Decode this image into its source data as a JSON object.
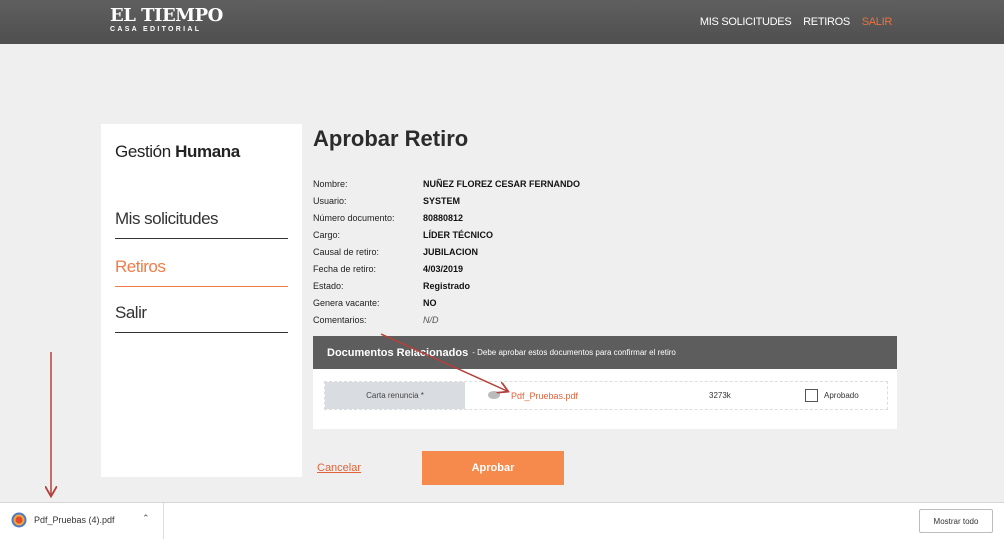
{
  "header": {
    "logo_title": "EL TIEMPO",
    "logo_subtitle": "CASA EDITORIAL",
    "nav": [
      "MIS SOLICITUDES",
      "RETIROS",
      "SALIR"
    ]
  },
  "sidebar": {
    "title_light": "Gestión",
    "title_bold": "Humana",
    "items": [
      "Mis solicitudes",
      "Retiros",
      "Salir"
    ],
    "active_index": 1
  },
  "main": {
    "title": "Aprobar Retiro",
    "fields": [
      {
        "label": "Nombre:",
        "value": "NUÑEZ FLOREZ CESAR FERNANDO"
      },
      {
        "label": "Usuario:",
        "value": "SYSTEM"
      },
      {
        "label": "Número documento:",
        "value": "80880812"
      },
      {
        "label": "Cargo:",
        "value": "LÍDER TÉCNICO"
      },
      {
        "label": "Causal de retiro:",
        "value": "JUBILACION"
      },
      {
        "label": "Fecha de retiro:",
        "value": "4/03/2019"
      },
      {
        "label": "Estado:",
        "value": "Registrado"
      },
      {
        "label": "Genera vacante:",
        "value": "NO"
      },
      {
        "label": "Comentarios:",
        "value": "N/D"
      }
    ],
    "documents": {
      "heading": "Documentos Relacionados",
      "subheading": "- Debe aprobar estos documentos para confirmar el retiro",
      "rows": [
        {
          "label": "Carta renuncia *",
          "file": "Pdf_Pruebas.pdf",
          "size": "3273k",
          "check_label": "Aprobado",
          "checked": false
        }
      ]
    },
    "cancel_label": "Cancelar",
    "approve_label": "Aprobar"
  },
  "download_bar": {
    "file_name": "Pdf_Pruebas (4).pdf",
    "show_all": "Mostrar todo"
  },
  "colors": {
    "accent": "#f58a4c",
    "link": "#e0633a",
    "header_bg": "#555555",
    "annotation_arrow": "#b5403a"
  }
}
